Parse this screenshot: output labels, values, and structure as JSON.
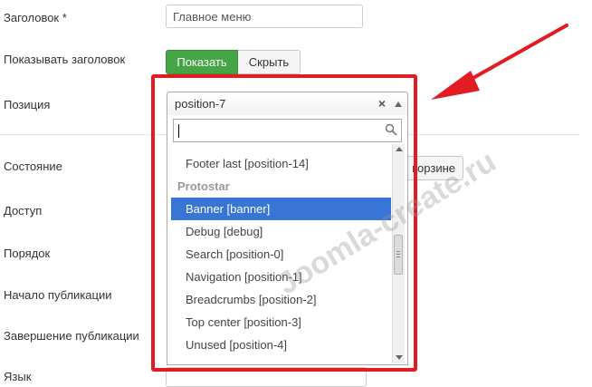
{
  "form": {
    "title_label": "Заголовок *",
    "title_value": "Главное меню",
    "show_title_label": "Показывать заголовок",
    "show_button": "Показать",
    "hide_button": "Скрыть",
    "position_label": "Позиция",
    "state_label": "Состояние",
    "trash_button_partial": "корзине",
    "access_label": "Доступ",
    "order_label": "Порядок",
    "publish_start_label": "Начало публикации",
    "publish_end_label": "Завершение публикации",
    "language_label_partial": "Язык"
  },
  "select": {
    "value": "position-7",
    "clear_icon": "close-icon",
    "search_value": "",
    "options": [
      {
        "label": "Footer last [position-14]"
      },
      {
        "label": "Protostar",
        "group": true
      },
      {
        "label": "Banner [banner]",
        "highlighted": true
      },
      {
        "label": "Debug [debug]"
      },
      {
        "label": "Search [position-0]"
      },
      {
        "label": "Navigation [position-1]"
      },
      {
        "label": "Breadcrumbs [position-2]"
      },
      {
        "label": "Top center [position-3]"
      },
      {
        "label": "Unused [position-4]"
      }
    ]
  },
  "annotation": {
    "frame_color": "#e31b23",
    "arrow_color": "#e31b23"
  },
  "watermark": "Joomla-create.ru",
  "colors": {
    "show_button_bg": "#46a546",
    "highlight_bg": "#3875d7"
  }
}
